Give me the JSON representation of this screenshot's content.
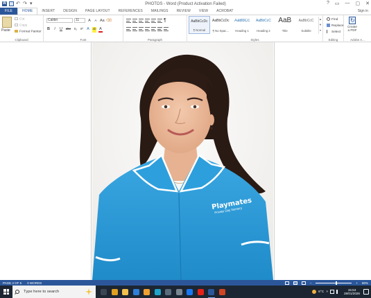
{
  "window": {
    "title": "PHOTOS - Word (Product Activation Failed)",
    "controls": [
      "?",
      "▭",
      "—",
      "▢",
      "✕"
    ]
  },
  "ribbon_tabs": [
    "FILE",
    "HOME",
    "INSERT",
    "DESIGN",
    "PAGE LAYOUT",
    "REFERENCES",
    "MAILINGS",
    "REVIEW",
    "VIEW",
    "ACROBAT"
  ],
  "active_tab": "HOME",
  "sign_in": "Sign in",
  "clipboard": {
    "paste": "Paste",
    "cut": "Cut",
    "copy": "Copy",
    "format_painter": "Format Painter",
    "label": "Clipboard"
  },
  "font": {
    "name": "Calibri",
    "size": "11",
    "grow": "A",
    "shrink": "A",
    "case": "Aa",
    "bold": "B",
    "italic": "I",
    "underline": "U",
    "strike": "abc",
    "sub": "x₂",
    "sup": "x²",
    "effects": "A",
    "highlight": "ab",
    "color": "A",
    "label": "Font"
  },
  "paragraph": {
    "label": "Paragraph",
    "pilcrow": "¶"
  },
  "styles": {
    "label": "Styles",
    "items": [
      {
        "sample": "AaBbCcDc",
        "name": "¶ Normal"
      },
      {
        "sample": "AaBbCcDc",
        "name": "¶ No Spac..."
      },
      {
        "sample": "AaBbCc",
        "name": "Heading 1"
      },
      {
        "sample": "AaBbCcC",
        "name": "Heading 2"
      },
      {
        "sample": "AaB",
        "name": "Title"
      },
      {
        "sample": "AaBbCcC",
        "name": "Subtitle"
      }
    ]
  },
  "editing": {
    "find": "Find",
    "replace": "Replace",
    "select": "Select",
    "label": "Editing"
  },
  "adobe": {
    "create_pdf_line1": "Create",
    "create_pdf_line2": "a PDF",
    "label": "Adobe A..."
  },
  "photo": {
    "shirt_text_1": "Playmates",
    "shirt_text_2": "Private Day Nursery"
  },
  "status": {
    "page": "PAGE 4 OF 5",
    "words": "0 WORDS",
    "zoom": "80%",
    "zoom_fraction": 0.55
  },
  "taskbar": {
    "search_placeholder": "Type here to search",
    "weather": "6°C",
    "time": "15:53",
    "date": "28/01/2026",
    "apps": [
      {
        "icon": "task-view-icon",
        "color": "#3c4652"
      },
      {
        "icon": "chrome-icon",
        "color": "#e0a020"
      },
      {
        "icon": "file-explorer-icon",
        "color": "#f2c14e"
      },
      {
        "icon": "mail-icon",
        "color": "#2f7fd8"
      },
      {
        "icon": "photos-icon",
        "color": "#f0a030"
      },
      {
        "icon": "edge-icon",
        "color": "#1fa3c8"
      },
      {
        "icon": "store-icon",
        "color": "#5a6b7c"
      },
      {
        "icon": "settings-icon",
        "color": "#7a8692"
      },
      {
        "icon": "facebook-icon",
        "color": "#1877f2"
      },
      {
        "icon": "youtube-icon",
        "color": "#e62117"
      },
      {
        "icon": "word-icon",
        "color": "#2b579a"
      },
      {
        "icon": "powerpoint-icon",
        "color": "#d04423"
      }
    ]
  },
  "colors": {
    "word_blue": "#2b579a",
    "taskbar": "#1c2632",
    "uniform": "#2a9ad8"
  }
}
